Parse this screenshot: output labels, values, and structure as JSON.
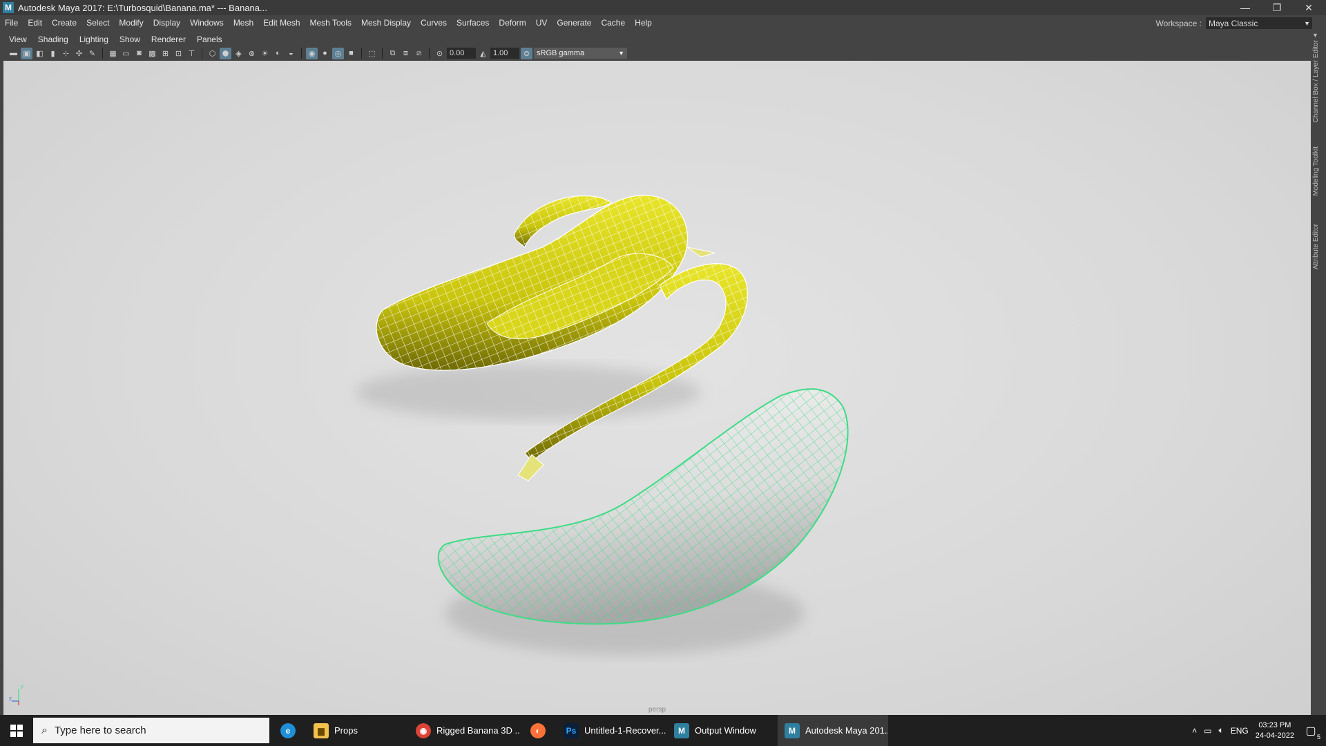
{
  "window": {
    "app_icon": "M",
    "title": "Autodesk Maya 2017: E:\\Turbosquid\\Banana.ma*  ---  Banana...",
    "controls": [
      "minimize-icon",
      "restore-icon",
      "close-icon"
    ]
  },
  "menubar": {
    "items": [
      "File",
      "Edit",
      "Create",
      "Select",
      "Modify",
      "Display",
      "Windows",
      "Mesh",
      "Edit Mesh",
      "Mesh Tools",
      "Mesh Display",
      "Curves",
      "Surfaces",
      "Deform",
      "UV",
      "Generate",
      "Cache",
      "Help"
    ],
    "workspace_label": "Workspace :",
    "workspace_value": "Maya Classic"
  },
  "panel_menu": {
    "items": [
      "View",
      "Shading",
      "Lighting",
      "Show",
      "Renderer",
      "Panels"
    ]
  },
  "view_toolbar": {
    "exposure": "0.00",
    "gamma": "1.00",
    "color_space": "sRGB gamma"
  },
  "viewport": {
    "camera_label": "persp",
    "axis_labels": {
      "y": "y",
      "z": "z"
    },
    "objects": [
      "peeled-banana-wireframe",
      "selected-banana-wireframe"
    ],
    "colors": {
      "peeled_banana": "#d4d010",
      "selected_wire": "#3ddc84",
      "background": "#d9d9d9"
    }
  },
  "right_tabs": [
    "Channel Box / Layer Editor",
    "Modeling Toolkit",
    "Attribute Editor"
  ],
  "taskbar": {
    "search_placeholder": "Type here to search",
    "apps": [
      {
        "label": "",
        "icon": "edge-icon"
      },
      {
        "label": "Props",
        "icon": "folder-icon"
      },
      {
        "label": "Rigged Banana 3D ...",
        "icon": "chrome-icon"
      },
      {
        "label": "",
        "icon": "firefox-icon"
      },
      {
        "label": "Untitled-1-Recover...",
        "icon": "photoshop-icon"
      },
      {
        "label": "Output Window",
        "icon": "maya-icon"
      },
      {
        "label": "Autodesk Maya 201...",
        "icon": "maya-icon"
      }
    ],
    "tray": {
      "language": "ENG",
      "time": "03:23 PM",
      "date": "24-04-2022",
      "notifications": "5"
    }
  }
}
